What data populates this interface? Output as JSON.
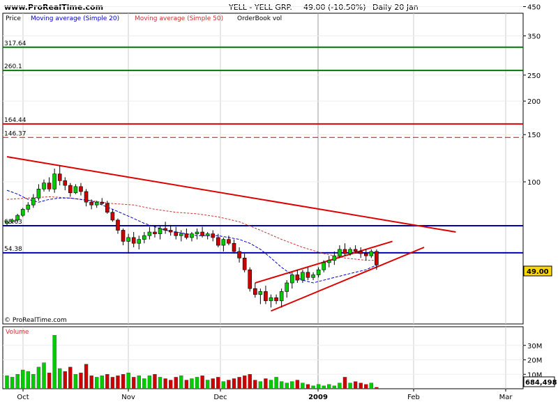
{
  "header": {
    "site": "www.ProRealTime.com",
    "instrument": "YELL - YELL GRP.",
    "quote": "49.00 (-10.50%)",
    "period": "Daily  20 Jan"
  },
  "legend": {
    "price": "Price",
    "ma20": "Moving average (Simple 20)",
    "ma50": "Moving average (Simple 50)",
    "orderbook": "OrderBook vol"
  },
  "watermark": "© ProRealTime.com",
  "volume_label": "Volume",
  "current_price_label": "49.00",
  "current_volume_label": "684,498",
  "colors": {
    "up": "#00cc00",
    "down": "#cc0000",
    "ma20": "#0000cc",
    "ma50": "#cc3333",
    "green_level": "#007700",
    "red_level": "#dd0000",
    "blue_level": "#0000aa",
    "trend": "#dd0000",
    "grid": "#cccccc",
    "price_badge": "#ffd700"
  },
  "chart_data": [
    {
      "type": "candlestick",
      "title": "YELL - YELL GRP.",
      "scale": "log",
      "ylim": [
        25,
        480
      ],
      "y_ticks": [
        450,
        350,
        250,
        200,
        150,
        100
      ],
      "x_ticks": [
        "Oct",
        "Nov",
        "Dec",
        "2009",
        "Feb",
        "Mar"
      ],
      "horizontal_levels": [
        {
          "value": 317.64,
          "label": "317.64",
          "color": "green_level",
          "style": "solid"
        },
        {
          "value": 260.1,
          "label": "260.1",
          "color": "green_level",
          "style": "solid"
        },
        {
          "value": 164.44,
          "label": "164.44",
          "color": "red_level",
          "style": "solid"
        },
        {
          "value": 146.37,
          "label": "146.37",
          "color": "red_level",
          "style": "dashed"
        },
        {
          "value": 68.63,
          "label": "68.63",
          "color": "blue_level",
          "style": "solid"
        },
        {
          "value": 54.38,
          "label": "54.38",
          "color": "blue_level",
          "style": "solid"
        }
      ],
      "trendlines": [
        {
          "from": [
            0,
            124
          ],
          "to": [
            85,
            65
          ]
        },
        {
          "from": [
            50,
            33
          ],
          "to": [
            79,
            57
          ]
        },
        {
          "from": [
            47,
            42
          ],
          "to": [
            73,
            60
          ]
        }
      ],
      "candles": [
        [
          0,
          70,
          72,
          69,
          71
        ],
        [
          1,
          71,
          73,
          70,
          72
        ],
        [
          2,
          72,
          76,
          71,
          75
        ],
        [
          3,
          75,
          80,
          74,
          79
        ],
        [
          4,
          79,
          84,
          77,
          82
        ],
        [
          5,
          82,
          90,
          80,
          87
        ],
        [
          6,
          87,
          98,
          85,
          94
        ],
        [
          7,
          94,
          102,
          92,
          99
        ],
        [
          8,
          99,
          104,
          92,
          94
        ],
        [
          9,
          94,
          112,
          91,
          107
        ],
        [
          10,
          107,
          115,
          97,
          101
        ],
        [
          11,
          101,
          104,
          93,
          97
        ],
        [
          12,
          97,
          99,
          88,
          91
        ],
        [
          13,
          91,
          98,
          90,
          96
        ],
        [
          14,
          96,
          99,
          89,
          92
        ],
        [
          15,
          92,
          94,
          81,
          84
        ],
        [
          16,
          84,
          86,
          79,
          82
        ],
        [
          17,
          82,
          85,
          80,
          84
        ],
        [
          18,
          84,
          87,
          82,
          83
        ],
        [
          19,
          83,
          85,
          76,
          77
        ],
        [
          20,
          77,
          79,
          71,
          72
        ],
        [
          21,
          72,
          73,
          64,
          66
        ],
        [
          22,
          66,
          67,
          58,
          60
        ],
        [
          23,
          60,
          64,
          54,
          62
        ],
        [
          24,
          62,
          65,
          57,
          59
        ],
        [
          25,
          59,
          63,
          56,
          61
        ],
        [
          26,
          61,
          65,
          59,
          63
        ],
        [
          27,
          63,
          68,
          61,
          65
        ],
        [
          28,
          65,
          69,
          62,
          64
        ],
        [
          29,
          64,
          69,
          61,
          67
        ],
        [
          30,
          67,
          71,
          64,
          66
        ],
        [
          31,
          66,
          69,
          63,
          65
        ],
        [
          32,
          65,
          68,
          61,
          63
        ],
        [
          33,
          63,
          66,
          60,
          64
        ],
        [
          34,
          64,
          67,
          61,
          62
        ],
        [
          35,
          62,
          65,
          60,
          64
        ],
        [
          36,
          64,
          67,
          61,
          65
        ],
        [
          37,
          65,
          68,
          62,
          63
        ],
        [
          38,
          63,
          65,
          61,
          64
        ],
        [
          39,
          64,
          66,
          60,
          62
        ],
        [
          40,
          62,
          64,
          57,
          58
        ],
        [
          41,
          58,
          62,
          55,
          61
        ],
        [
          42,
          61,
          63,
          58,
          59
        ],
        [
          43,
          59,
          61,
          54,
          55
        ],
        [
          44,
          55,
          57,
          50,
          52
        ],
        [
          45,
          52,
          54,
          46,
          47
        ],
        [
          46,
          47,
          48,
          39,
          40
        ],
        [
          47,
          40,
          42,
          37,
          38
        ],
        [
          48,
          38,
          40,
          35,
          39
        ],
        [
          49,
          39,
          41,
          35,
          36
        ],
        [
          50,
          36,
          38,
          34,
          37
        ],
        [
          51,
          37,
          38,
          35,
          36
        ],
        [
          52,
          36,
          40,
          34,
          39
        ],
        [
          53,
          39,
          43,
          37,
          42
        ],
        [
          54,
          42,
          46,
          40,
          45
        ],
        [
          55,
          45,
          47,
          42,
          43
        ],
        [
          56,
          43,
          47,
          42,
          46
        ],
        [
          57,
          46,
          48,
          43,
          44
        ],
        [
          58,
          44,
          46,
          43,
          45
        ],
        [
          59,
          45,
          48,
          44,
          47
        ],
        [
          60,
          47,
          51,
          46,
          50
        ],
        [
          61,
          50,
          53,
          48,
          51
        ],
        [
          62,
          51,
          55,
          49,
          53
        ],
        [
          63,
          53,
          58,
          52,
          56
        ],
        [
          64,
          56,
          59,
          53,
          54
        ],
        [
          65,
          54,
          57,
          53,
          56
        ],
        [
          66,
          56,
          58,
          54,
          55
        ],
        [
          67,
          55,
          57,
          52,
          54
        ],
        [
          68,
          54,
          56,
          51,
          53
        ],
        [
          69,
          53,
          56,
          52,
          55
        ],
        [
          70,
          55,
          56,
          47,
          49
        ]
      ],
      "ma20": [
        [
          0,
          93
        ],
        [
          2,
          90
        ],
        [
          4,
          86
        ],
        [
          6,
          84
        ],
        [
          8,
          86
        ],
        [
          10,
          87
        ],
        [
          12,
          87
        ],
        [
          14,
          86
        ],
        [
          16,
          85
        ],
        [
          18,
          82
        ],
        [
          20,
          79
        ],
        [
          22,
          76
        ],
        [
          24,
          73
        ],
        [
          26,
          70
        ],
        [
          28,
          68
        ],
        [
          30,
          66
        ],
        [
          32,
          65
        ],
        [
          34,
          64
        ],
        [
          36,
          63
        ],
        [
          38,
          63
        ],
        [
          40,
          63
        ],
        [
          42,
          62
        ],
        [
          44,
          61
        ],
        [
          46,
          59
        ],
        [
          48,
          56
        ],
        [
          50,
          52
        ],
        [
          52,
          48
        ],
        [
          54,
          45
        ],
        [
          56,
          43
        ],
        [
          58,
          42
        ],
        [
          60,
          43
        ],
        [
          62,
          44
        ],
        [
          64,
          45
        ],
        [
          66,
          46
        ],
        [
          68,
          47
        ],
        [
          70,
          49
        ]
      ],
      "ma50": [
        [
          0,
          86
        ],
        [
          4,
          87
        ],
        [
          8,
          88
        ],
        [
          12,
          87
        ],
        [
          16,
          85
        ],
        [
          20,
          83
        ],
        [
          24,
          82
        ],
        [
          28,
          79
        ],
        [
          32,
          77
        ],
        [
          36,
          76
        ],
        [
          40,
          74
        ],
        [
          44,
          71
        ],
        [
          48,
          66
        ],
        [
          52,
          61
        ],
        [
          56,
          57
        ],
        [
          60,
          54
        ],
        [
          64,
          52
        ],
        [
          68,
          51
        ],
        [
          70,
          51
        ]
      ]
    },
    {
      "type": "bar",
      "title": "Volume",
      "ylim": [
        0,
        40
      ],
      "y_ticks": [
        "30M",
        "20M",
        "10M"
      ],
      "values": [
        9,
        8,
        10,
        13,
        12,
        10,
        15,
        18,
        11,
        37,
        14,
        12,
        15,
        10,
        11,
        17,
        9,
        8,
        9,
        10,
        8,
        9,
        10,
        11,
        8,
        9,
        7,
        9,
        10,
        8,
        7,
        6,
        8,
        9,
        6,
        7,
        8,
        9,
        6,
        7,
        8,
        5,
        6,
        7,
        8,
        9,
        10,
        6,
        5,
        7,
        6,
        8,
        5,
        4,
        5,
        6,
        4,
        3,
        2,
        3,
        2,
        3,
        2,
        4,
        8,
        4,
        5,
        4,
        3,
        4,
        1
      ],
      "directions": [
        1,
        1,
        1,
        1,
        1,
        1,
        1,
        1,
        -1,
        1,
        1,
        -1,
        -1,
        1,
        -1,
        -1,
        -1,
        1,
        1,
        -1,
        -1,
        -1,
        -1,
        1,
        -1,
        1,
        1,
        1,
        -1,
        1,
        -1,
        -1,
        -1,
        1,
        -1,
        1,
        1,
        -1,
        1,
        -1,
        -1,
        1,
        -1,
        -1,
        -1,
        -1,
        -1,
        -1,
        1,
        -1,
        1,
        1,
        1,
        1,
        1,
        -1,
        1,
        -1,
        1,
        1,
        1,
        1,
        1,
        1,
        -1,
        1,
        -1,
        -1,
        -1,
        1,
        -1
      ]
    }
  ]
}
